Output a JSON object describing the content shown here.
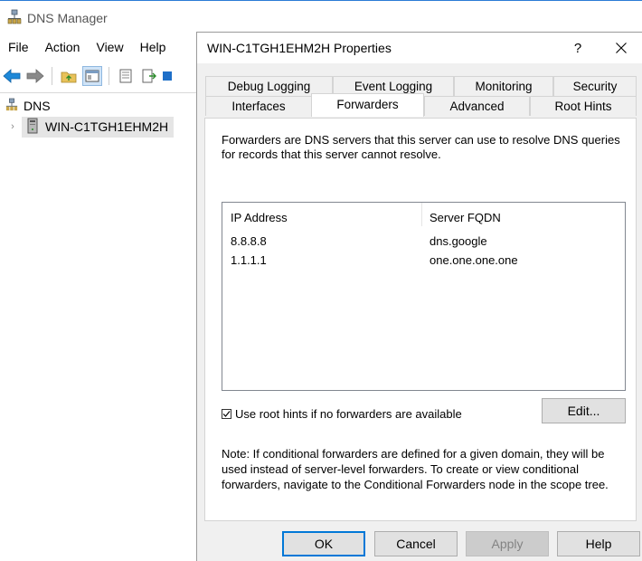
{
  "manager": {
    "title": "DNS Manager",
    "menu": [
      "File",
      "Action",
      "View",
      "Help"
    ],
    "tree": {
      "root": "DNS",
      "server": "WIN-C1TGH1EHM2H"
    }
  },
  "dialog": {
    "title": "WIN-C1TGH1EHM2H Properties",
    "help_glyph": "?",
    "tabs_back": [
      "Debug Logging",
      "Event Logging",
      "Monitoring",
      "Security"
    ],
    "tabs_front": [
      "Interfaces",
      "Forwarders",
      "Advanced",
      "Root Hints"
    ],
    "active_tab": "Forwarders",
    "description": "Forwarders are DNS servers that this server can use to resolve DNS queries for records that this server cannot resolve.",
    "list": {
      "headers": [
        "IP Address",
        "Server FQDN"
      ],
      "rows": [
        {
          "ip": "8.8.8.8",
          "fqdn": "dns.google"
        },
        {
          "ip": "1.1.1.1",
          "fqdn": "one.one.one.one"
        }
      ]
    },
    "use_root_hints": {
      "checked": true,
      "label": "Use root hints if no forwarders are available"
    },
    "edit_label": "Edit...",
    "note": "Note: If conditional forwarders are defined for a given domain, they will be used instead of server-level forwarders.  To create or view conditional forwarders, navigate to the Conditional Forwarders node in the scope tree.",
    "buttons": {
      "ok": "OK",
      "cancel": "Cancel",
      "apply": "Apply",
      "help": "Help"
    }
  },
  "colors": {
    "accent": "#0078d7",
    "dialog_bg": "#f0f0f0"
  }
}
